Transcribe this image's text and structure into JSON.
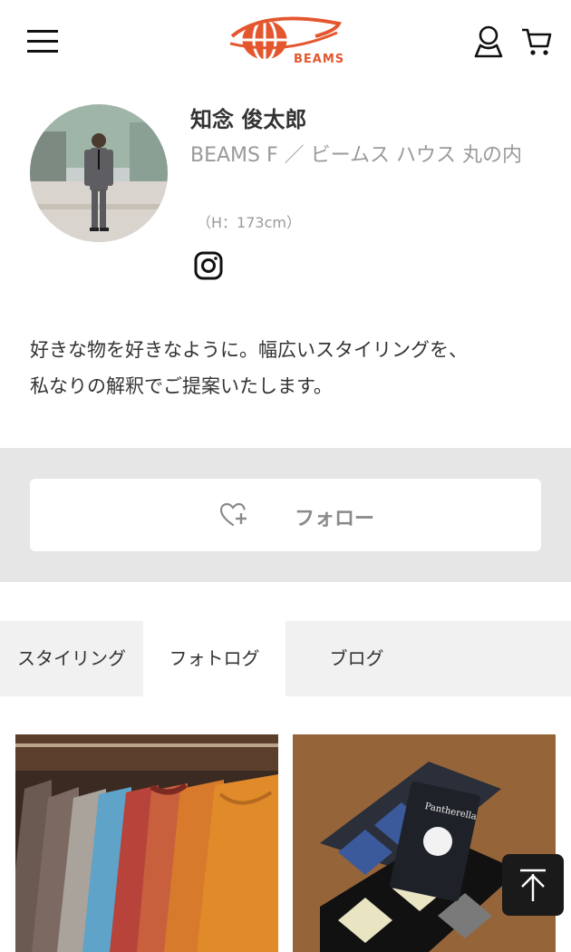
{
  "header": {
    "menu_icon": "hamburger-menu-icon",
    "logo_text": "BEAMS",
    "account_icon": "user-account-icon",
    "cart_icon": "shopping-cart-icon",
    "brand_color": "#e4572e"
  },
  "profile": {
    "name": "知念 俊太郎",
    "shop": "BEAMS F ／ ビームス ハウス 丸の内",
    "height": "（H：173cm）",
    "instagram_icon": "instagram-icon",
    "bio_line1": "好きな物を好きなように。幅広いスタイリングを、",
    "bio_line2": "私なりの解釈でご提案いたします。"
  },
  "follow": {
    "label": "フォロー",
    "icon": "heart-plus-icon"
  },
  "tabs": [
    {
      "label": "スタイリング",
      "active": false
    },
    {
      "label": "フォトログ",
      "active": true
    },
    {
      "label": "ブログ",
      "active": false
    }
  ],
  "photos": [
    {
      "name": "knit-sweaters-photo"
    },
    {
      "name": "argyle-socks-photo"
    }
  ],
  "scroll_top_icon": "arrow-up-icon"
}
